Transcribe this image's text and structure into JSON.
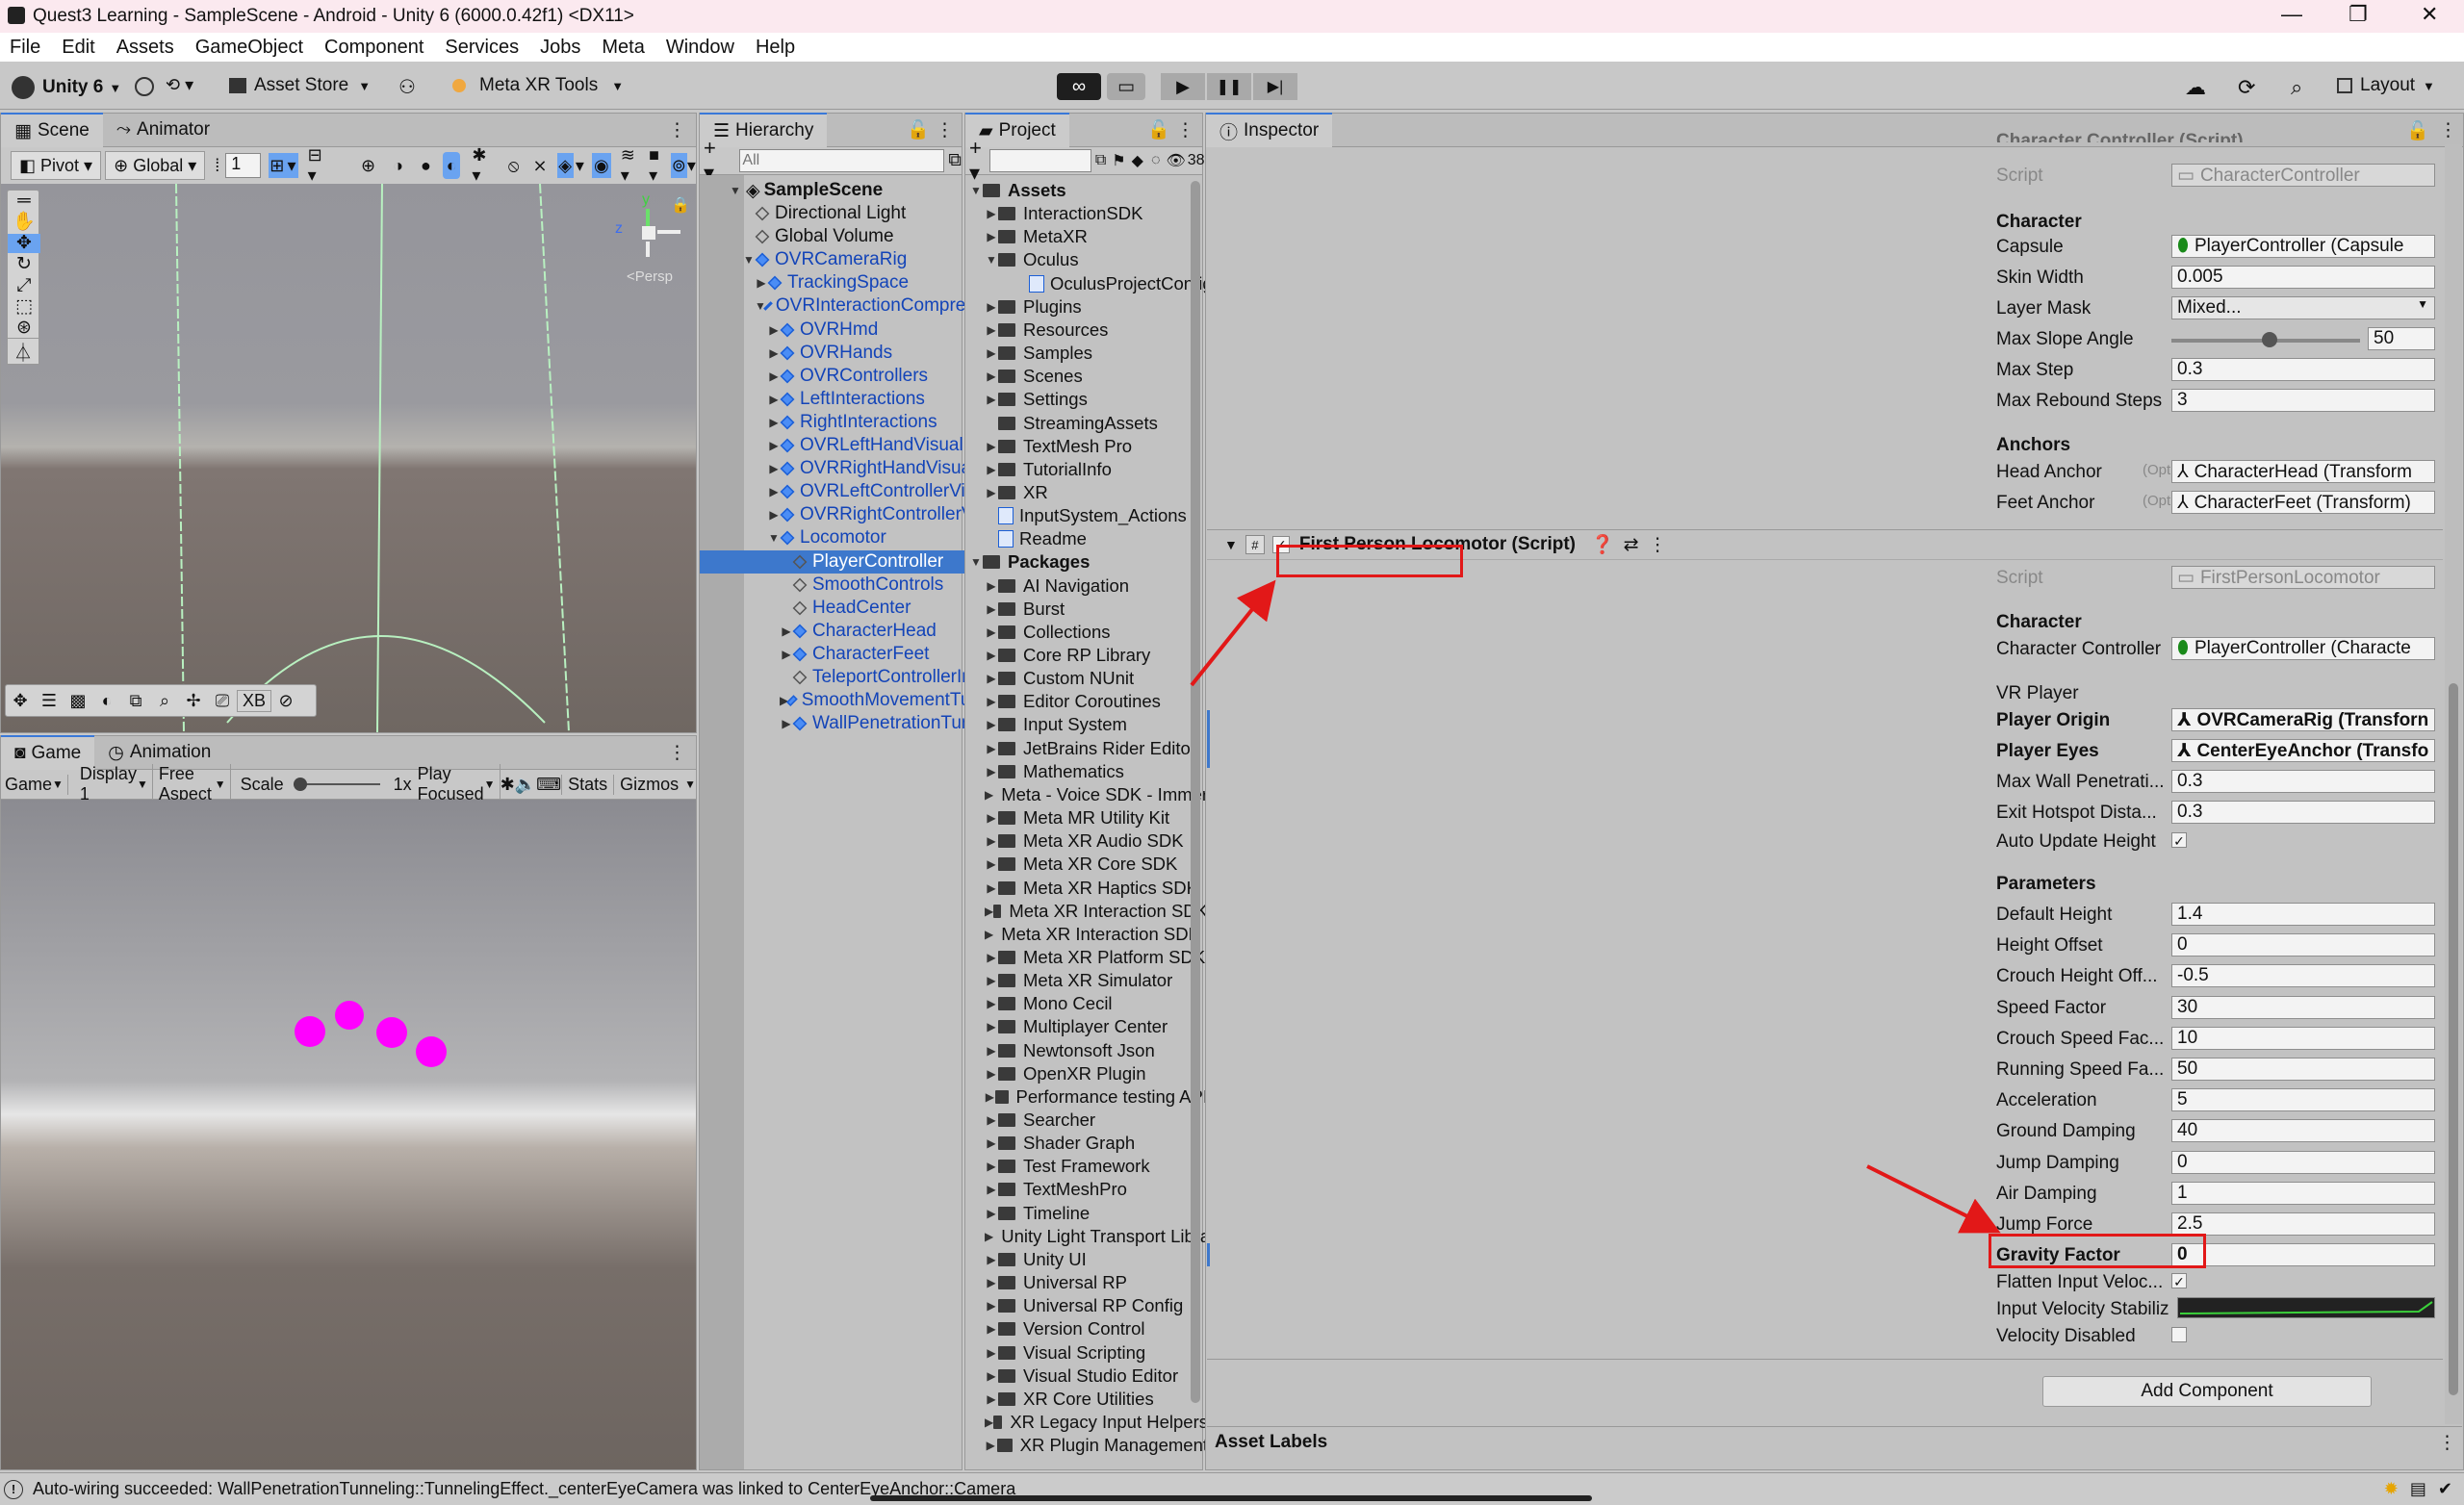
{
  "window": {
    "title": "Quest3 Learning - SampleScene - Android - Unity 6 (6000.0.42f1) <DX11>",
    "minimize": "—",
    "maximize": "❐",
    "close": "✕"
  },
  "menu": [
    "File",
    "Edit",
    "Assets",
    "GameObject",
    "Component",
    "Services",
    "Jobs",
    "Meta",
    "Window",
    "Help"
  ],
  "toolbar": {
    "account": "Unity 6",
    "asset_store": "Asset Store",
    "meta_tools": "Meta XR Tools",
    "layout": "Layout"
  },
  "scene": {
    "tab_scene": "Scene",
    "tab_animator": "Animator",
    "pivot": "Pivot",
    "global": "Global",
    "grid_value": "1",
    "persp": "<Persp",
    "axis_y": "y",
    "axis_z": "z",
    "xb": "XB"
  },
  "game": {
    "tab_game": "Game",
    "tab_animation": "Animation",
    "view_select": "Game",
    "display": "Display 1",
    "aspect": "Free Aspect",
    "scale_label": "Scale",
    "scale_value": "1x",
    "play_focused": "Play Focused",
    "stats": "Stats",
    "gizmos": "Gizmos"
  },
  "hierarchy": {
    "tab": "Hierarchy",
    "search_placeholder": "All",
    "scene_name": "SampleScene",
    "items": [
      {
        "label": "Directional Light",
        "depth": 1,
        "blue": false,
        "arrow": false
      },
      {
        "label": "Global Volume",
        "depth": 1,
        "blue": false,
        "arrow": false
      },
      {
        "label": "OVRCameraRig",
        "depth": 1,
        "blue": true,
        "arrow": "open"
      },
      {
        "label": "TrackingSpace",
        "depth": 2,
        "blue": true,
        "arrow": "closed"
      },
      {
        "label": "OVRInteractionComprehensive",
        "depth": 2,
        "blue": true,
        "arrow": "open"
      },
      {
        "label": "OVRHmd",
        "depth": 3,
        "blue": true,
        "arrow": "closed"
      },
      {
        "label": "OVRHands",
        "depth": 3,
        "blue": true,
        "arrow": "closed"
      },
      {
        "label": "OVRControllers",
        "depth": 3,
        "blue": true,
        "arrow": "closed"
      },
      {
        "label": "LeftInteractions",
        "depth": 3,
        "blue": true,
        "arrow": "closed"
      },
      {
        "label": "RightInteractions",
        "depth": 3,
        "blue": true,
        "arrow": "closed"
      },
      {
        "label": "OVRLeftHandVisual",
        "depth": 3,
        "blue": true,
        "arrow": "closed"
      },
      {
        "label": "OVRRightHandVisual",
        "depth": 3,
        "blue": true,
        "arrow": "closed"
      },
      {
        "label": "OVRLeftControllerVisual",
        "depth": 3,
        "blue": true,
        "arrow": "closed"
      },
      {
        "label": "OVRRightControllerVisual",
        "depth": 3,
        "blue": true,
        "arrow": "closed"
      },
      {
        "label": "Locomotor",
        "depth": 3,
        "blue": true,
        "arrow": "open"
      },
      {
        "label": "PlayerController",
        "depth": 4,
        "blue": true,
        "arrow": false,
        "selected": true
      },
      {
        "label": "SmoothControls",
        "depth": 4,
        "blue": true,
        "arrow": false
      },
      {
        "label": "HeadCenter",
        "depth": 4,
        "blue": true,
        "arrow": false
      },
      {
        "label": "CharacterHead",
        "depth": 4,
        "blue": true,
        "arrow": "closed"
      },
      {
        "label": "CharacterFeet",
        "depth": 4,
        "blue": true,
        "arrow": "closed"
      },
      {
        "label": "TeleportControllerInteractor",
        "depth": 4,
        "blue": true,
        "arrow": false
      },
      {
        "label": "SmoothMovementTunneling",
        "depth": 4,
        "blue": true,
        "arrow": "closed"
      },
      {
        "label": "WallPenetrationTunneling",
        "depth": 4,
        "blue": true,
        "arrow": "closed"
      }
    ]
  },
  "project": {
    "tab": "Project",
    "count": "38",
    "items": [
      {
        "label": "Assets",
        "depth": 0,
        "bold": true
      },
      {
        "label": "InteractionSDK",
        "depth": 1
      },
      {
        "label": "MetaXR",
        "depth": 1
      },
      {
        "label": "Oculus",
        "depth": 1,
        "open": true
      },
      {
        "label": "OculusProjectConfig",
        "depth": 2,
        "asset": true
      },
      {
        "label": "Plugins",
        "depth": 1
      },
      {
        "label": "Resources",
        "depth": 1
      },
      {
        "label": "Samples",
        "depth": 1
      },
      {
        "label": "Scenes",
        "depth": 1
      },
      {
        "label": "Settings",
        "depth": 1
      },
      {
        "label": "StreamingAssets",
        "depth": 1,
        "noarrow": true
      },
      {
        "label": "TextMesh Pro",
        "depth": 1
      },
      {
        "label": "TutorialInfo",
        "depth": 1
      },
      {
        "label": "XR",
        "depth": 1
      },
      {
        "label": "InputSystem_Actions",
        "depth": 1,
        "asset": true
      },
      {
        "label": "Readme",
        "depth": 1,
        "asset": true
      },
      {
        "label": "Packages",
        "depth": 0,
        "bold": true
      },
      {
        "label": "AI Navigation",
        "depth": 1
      },
      {
        "label": "Burst",
        "depth": 1
      },
      {
        "label": "Collections",
        "depth": 1
      },
      {
        "label": "Core RP Library",
        "depth": 1
      },
      {
        "label": "Custom NUnit",
        "depth": 1
      },
      {
        "label": "Editor Coroutines",
        "depth": 1
      },
      {
        "label": "Input System",
        "depth": 1
      },
      {
        "label": "JetBrains Rider Editor",
        "depth": 1
      },
      {
        "label": "Mathematics",
        "depth": 1
      },
      {
        "label": "Meta - Voice SDK - Immersive Voice (",
        "depth": 1
      },
      {
        "label": "Meta MR Utility Kit",
        "depth": 1
      },
      {
        "label": "Meta XR Audio SDK",
        "depth": 1
      },
      {
        "label": "Meta XR Core SDK",
        "depth": 1
      },
      {
        "label": "Meta XR Haptics SDK",
        "depth": 1
      },
      {
        "label": "Meta XR Interaction SDK",
        "depth": 1
      },
      {
        "label": "Meta XR Interaction SDK Essentials",
        "depth": 1
      },
      {
        "label": "Meta XR Platform SDK",
        "depth": 1
      },
      {
        "label": "Meta XR Simulator",
        "depth": 1
      },
      {
        "label": "Mono Cecil",
        "depth": 1
      },
      {
        "label": "Multiplayer Center",
        "depth": 1
      },
      {
        "label": "Newtonsoft Json",
        "depth": 1
      },
      {
        "label": "OpenXR Plugin",
        "depth": 1
      },
      {
        "label": "Performance testing API",
        "depth": 1
      },
      {
        "label": "Searcher",
        "depth": 1
      },
      {
        "label": "Shader Graph",
        "depth": 1
      },
      {
        "label": "Test Framework",
        "depth": 1
      },
      {
        "label": "TextMeshPro",
        "depth": 1
      },
      {
        "label": "Timeline",
        "depth": 1
      },
      {
        "label": "Unity Light Transport Library",
        "depth": 1
      },
      {
        "label": "Unity UI",
        "depth": 1
      },
      {
        "label": "Universal RP",
        "depth": 1
      },
      {
        "label": "Universal RP Config",
        "depth": 1
      },
      {
        "label": "Version Control",
        "depth": 1
      },
      {
        "label": "Visual Scripting",
        "depth": 1
      },
      {
        "label": "Visual Studio Editor",
        "depth": 1
      },
      {
        "label": "XR Core Utilities",
        "depth": 1
      },
      {
        "label": "XR Legacy Input Helpers",
        "depth": 1
      },
      {
        "label": "XR Plugin Management",
        "depth": 1
      }
    ]
  },
  "inspector": {
    "tab": "Inspector",
    "top_cut": "Character Controller (Script)",
    "script_label": "Script",
    "script1": "CharacterController",
    "section_character": "Character",
    "capsule_label": "Capsule",
    "capsule": "PlayerController (Capsule",
    "skin_label": "Skin Width",
    "skin": "0.005",
    "layer_label": "Layer Mask",
    "layer": "Mixed...",
    "slope_label": "Max Slope Angle",
    "slope": "50",
    "slope_fraction": 0.52,
    "step_label": "Max Step",
    "step": "0.3",
    "rebound_label": "Max Rebound Steps",
    "rebound": "3",
    "section_anchors": "Anchors",
    "head_label": "Head Anchor",
    "opt": "(Opt",
    "head": "CharacterHead (Transform",
    "feet_label": "Feet Anchor",
    "feet": "CharacterFeet (Transform)",
    "component2": "First Person Locomotor (Script)",
    "script2": "FirstPersonLocomotor",
    "cc_label": "Character Controller",
    "cc": "PlayerController (Characte",
    "section_vr": "VR Player",
    "origin_label": "Player Origin",
    "origin": "OVRCameraRig (Transforn",
    "eyes_label": "Player Eyes",
    "eyes": "CenterEyeAnchor (Transfo",
    "wall_label": "Max Wall Penetrati...",
    "wall": "0.3",
    "exit_label": "Exit Hotspot Dista...",
    "exit": "0.3",
    "auto_label": "Auto Update Height",
    "section_params": "Parameters",
    "params": [
      {
        "label": "Default Height",
        "value": "1.4"
      },
      {
        "label": "Height Offset",
        "value": "0"
      },
      {
        "label": "Crouch Height Off...",
        "value": "-0.5"
      },
      {
        "label": "Speed Factor",
        "value": "30"
      },
      {
        "label": "Crouch Speed Fac...",
        "value": "10"
      },
      {
        "label": "Running Speed Fa...",
        "value": "50"
      },
      {
        "label": "Acceleration",
        "value": "5"
      },
      {
        "label": "Ground Damping",
        "value": "40"
      },
      {
        "label": "Jump Damping",
        "value": "0"
      },
      {
        "label": "Air Damping",
        "value": "1"
      },
      {
        "label": "Jump Force",
        "value": "2.5"
      },
      {
        "label": "Gravity Factor",
        "value": "0"
      }
    ],
    "flatten_label": "Flatten Input Veloc...",
    "stabil_label": "Input Velocity Stabiliz",
    "vdisabled_label": "Velocity Disabled",
    "add_component": "Add Component",
    "asset_labels": "Asset Labels"
  },
  "status": {
    "message": "Auto-wiring succeeded: WallPenetrationTunneling::TunnelingEffect._centerEyeCamera was linked to CenterEyeAnchor::Camera"
  },
  "colors": {
    "accent": "#3d78cc",
    "annotation_red": "#e21818",
    "sphere": "#ff00ff"
  }
}
